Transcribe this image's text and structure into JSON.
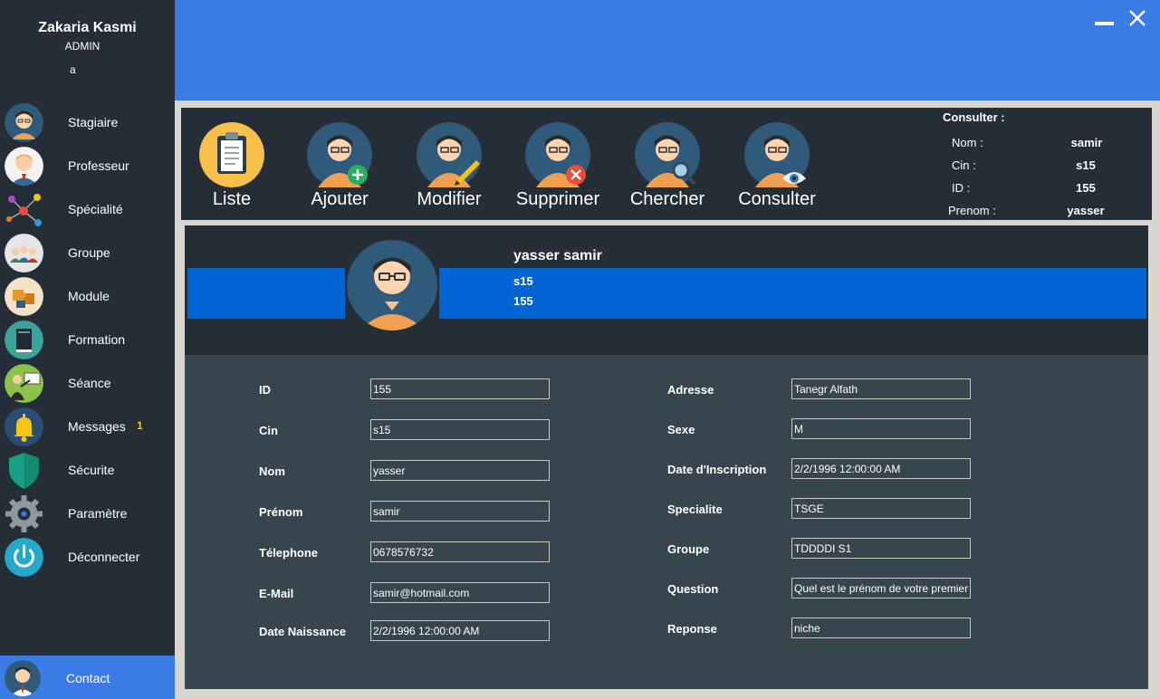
{
  "user": {
    "name": "Zakaria Kasmi",
    "role": "ADMIN",
    "extra": "a"
  },
  "sidebar": {
    "items": [
      {
        "label": "Stagiaire",
        "icon": "stagiaire-avatar-icon"
      },
      {
        "label": "Professeur",
        "icon": "professeur-avatar-icon"
      },
      {
        "label": "Spécialité",
        "icon": "specialite-network-icon"
      },
      {
        "label": "Groupe",
        "icon": "groupe-people-icon"
      },
      {
        "label": "Module",
        "icon": "module-puzzle-icon"
      },
      {
        "label": "Formation",
        "icon": "formation-book-icon"
      },
      {
        "label": "Séance",
        "icon": "seance-teacher-icon"
      },
      {
        "label": "Messages",
        "icon": "messages-bell-icon",
        "badge": "1"
      },
      {
        "label": "Sécurite",
        "icon": "securite-shield-icon"
      },
      {
        "label": "Paramètre",
        "icon": "parametre-gear-icon"
      },
      {
        "label": "Déconnecter",
        "icon": "deconnecter-power-icon"
      }
    ],
    "contact": {
      "label": "Contact",
      "icon": "contact-avatar-icon"
    }
  },
  "toolbar": {
    "items": [
      {
        "label": "Liste",
        "icon": "clipboard-icon"
      },
      {
        "label": "Ajouter",
        "icon": "user-add-icon"
      },
      {
        "label": "Modifier",
        "icon": "user-edit-icon"
      },
      {
        "label": "Supprimer",
        "icon": "user-delete-icon"
      },
      {
        "label": "Chercher",
        "icon": "user-search-icon"
      },
      {
        "label": "Consulter",
        "icon": "user-view-icon"
      }
    ]
  },
  "consult": {
    "title": "Consulter :",
    "rows": [
      {
        "label": "Nom :",
        "value": "samir"
      },
      {
        "label": "Cin :",
        "value": "s15"
      },
      {
        "label": "ID :",
        "value": "155"
      },
      {
        "label": "Prenom :",
        "value": "yasser"
      }
    ]
  },
  "profile": {
    "name": "yasser samir",
    "cin": "s15",
    "id": "155"
  },
  "form": {
    "left": [
      {
        "label": "ID",
        "value": "155"
      },
      {
        "label": "Cin",
        "value": "s15"
      },
      {
        "label": "Nom",
        "value": "yasser"
      },
      {
        "label": "Prénom",
        "value": "samir"
      },
      {
        "label": "Télephone",
        "value": "0678576732"
      },
      {
        "label": "E-Mail",
        "value": "samir@hotmail.com"
      },
      {
        "label": "Date Naissance",
        "value": "2/2/1996 12:00:00 AM"
      }
    ],
    "right": [
      {
        "label": "Adresse",
        "value": "Tanegr Alfath"
      },
      {
        "label": "Sexe",
        "value": "M"
      },
      {
        "label": "Date d'Inscription",
        "value": "2/2/1996 12:00:00 AM"
      },
      {
        "label": "Specialite",
        "value": "TSGE"
      },
      {
        "label": "Groupe",
        "value": "TDDDDI S1"
      },
      {
        "label": "Question",
        "value": "Quel est le prénom de votre premier"
      },
      {
        "label": "Reponse",
        "value": "niche"
      }
    ]
  },
  "colors": {
    "accent": "#3b7be5",
    "band": "#0064d2",
    "dark": "#252e37",
    "panel": "#37454f",
    "badge": "#f5c518"
  }
}
